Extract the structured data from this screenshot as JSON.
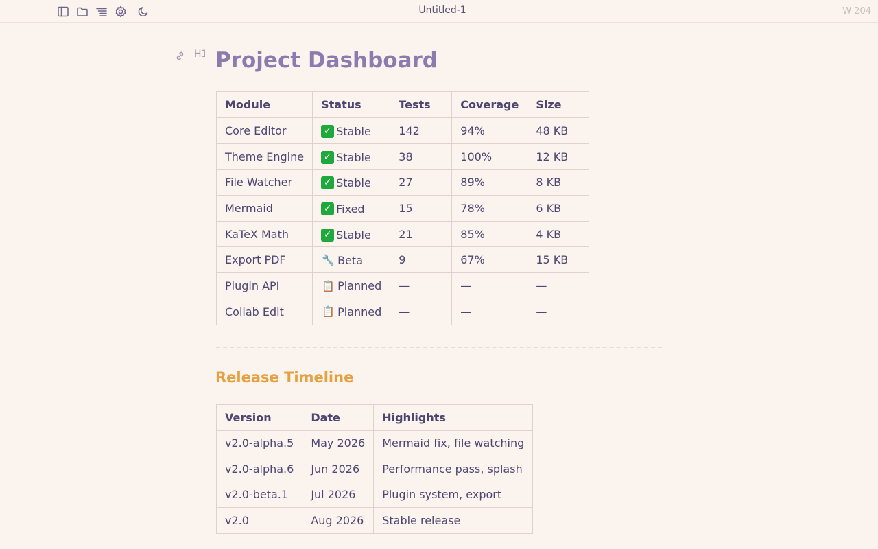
{
  "window": {
    "title": "Untitled-1",
    "word_count": "W 204"
  },
  "toolbar": {
    "icons": [
      "sidebar-icon",
      "folder-icon",
      "outline-icon",
      "gear-icon",
      "moon-icon"
    ]
  },
  "gutter": {
    "heading_marker": "H1"
  },
  "document": {
    "title": "Project Dashboard",
    "dashboard_table": {
      "headers": [
        "Module",
        "Status",
        "Tests",
        "Coverage",
        "Size"
      ],
      "rows": [
        {
          "module": "Core Editor",
          "status_icon": "check",
          "status": "Stable",
          "tests": "142",
          "coverage": "94%",
          "size": "48 KB"
        },
        {
          "module": "Theme Engine",
          "status_icon": "check",
          "status": "Stable",
          "tests": "38",
          "coverage": "100%",
          "size": "12 KB"
        },
        {
          "module": "File Watcher",
          "status_icon": "check",
          "status": "Stable",
          "tests": "27",
          "coverage": "89%",
          "size": "8 KB"
        },
        {
          "module": "Mermaid",
          "status_icon": "check",
          "status": "Fixed",
          "tests": "15",
          "coverage": "78%",
          "size": "6 KB"
        },
        {
          "module": "KaTeX Math",
          "status_icon": "check",
          "status": "Stable",
          "tests": "21",
          "coverage": "85%",
          "size": "4 KB"
        },
        {
          "module": "Export PDF",
          "status_icon": "wrench",
          "status": "Beta",
          "tests": "9",
          "coverage": "67%",
          "size": "15 KB"
        },
        {
          "module": "Plugin API",
          "status_icon": "clipboard",
          "status": "Planned",
          "tests": "—",
          "coverage": "—",
          "size": "—"
        },
        {
          "module": "Collab Edit",
          "status_icon": "clipboard",
          "status": "Planned",
          "tests": "—",
          "coverage": "—",
          "size": "—"
        }
      ]
    },
    "section_title": "Release Timeline",
    "release_table": {
      "headers": [
        "Version",
        "Date",
        "Highlights"
      ],
      "rows": [
        {
          "version": "v2.0-alpha.5",
          "date": "May 2026",
          "highlights": "Mermaid fix, file watching"
        },
        {
          "version": "v2.0-alpha.6",
          "date": "Jun 2026",
          "highlights": "Performance pass, splash"
        },
        {
          "version": "v2.0-beta.1",
          "date": "Jul 2026",
          "highlights": "Plugin system, export"
        },
        {
          "version": "v2.0",
          "date": "Aug 2026",
          "highlights": "Stable release"
        }
      ]
    }
  },
  "colors": {
    "background": "#faf3ee",
    "h1": "#8c7bae",
    "h2": "#e5a13f",
    "text": "#4d4670",
    "check": "#1fa83c"
  }
}
